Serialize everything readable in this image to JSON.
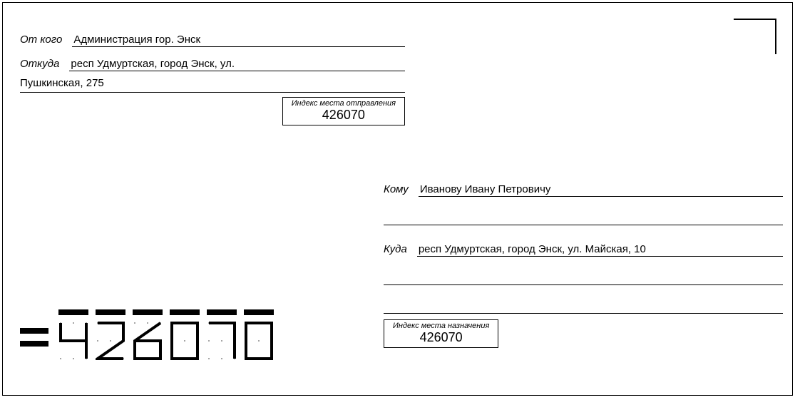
{
  "sender": {
    "from_label": "От кого",
    "from_value": "Администрация гор. Энск",
    "address_label": "Откуда",
    "address_value": "респ Удмуртская, город Энск, ул.",
    "address_continuation": "Пушкинская, 275",
    "index_label": "Индекс места отправления",
    "index_value": "426070"
  },
  "recipient": {
    "to_label": "Кому",
    "to_value": "Иванову Ивану Петровичу",
    "address_label": "Куда",
    "address_value": "респ Удмуртская, город Энск, ул. Майская, 10",
    "index_label": "Индекс места назначения",
    "index_value": "426070"
  },
  "postal_code": "426070"
}
